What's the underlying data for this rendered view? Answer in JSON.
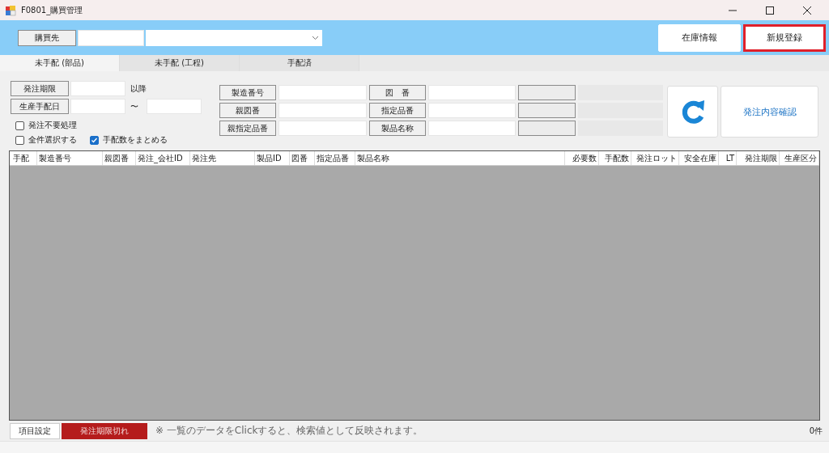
{
  "window": {
    "title": "F0801_購買管理"
  },
  "header": {
    "supplier_button": "購買先",
    "buttons": [
      {
        "label": "在庫情報",
        "highlighted": false
      },
      {
        "label": "新規登録",
        "highlighted": true
      }
    ]
  },
  "tabs": [
    {
      "label": "未手配 (部品)",
      "selected": true
    },
    {
      "label": "未手配 (工程)",
      "selected": false
    },
    {
      "label": "手配済",
      "selected": false
    }
  ],
  "date_filters": [
    {
      "label": "発注期限",
      "kind": "after",
      "text": "以降"
    },
    {
      "label": "生産手配日",
      "kind": "range",
      "text": "〜"
    }
  ],
  "checkbox_rows": [
    [
      {
        "label": "発注不要処理",
        "checked": false
      }
    ],
    [
      {
        "label": "全件選択する",
        "checked": false
      },
      {
        "label": "手配数をまとめる",
        "checked": true
      }
    ]
  ],
  "search_groups": [
    [
      "製造番号",
      "親図番",
      "親指定品番"
    ],
    [
      "図　番",
      "指定品番",
      "製品名称"
    ]
  ],
  "confirm_button": "発注内容確認",
  "table": {
    "columns": [
      "手配",
      "製造番号",
      "親図番",
      "発注_会社ID",
      "発注先",
      "製品ID",
      "図番",
      "指定品番",
      "製品名称",
      "必要数",
      "手配数",
      "発注ロット",
      "安全在庫",
      "LT",
      "発注期限",
      "生産区分"
    ]
  },
  "footer": {
    "settings_button": "項目設定",
    "overdue_label": "発注期限切れ",
    "note": "※ 一覧のデータをClickすると、検索値として反映されます。",
    "count": "0件"
  }
}
